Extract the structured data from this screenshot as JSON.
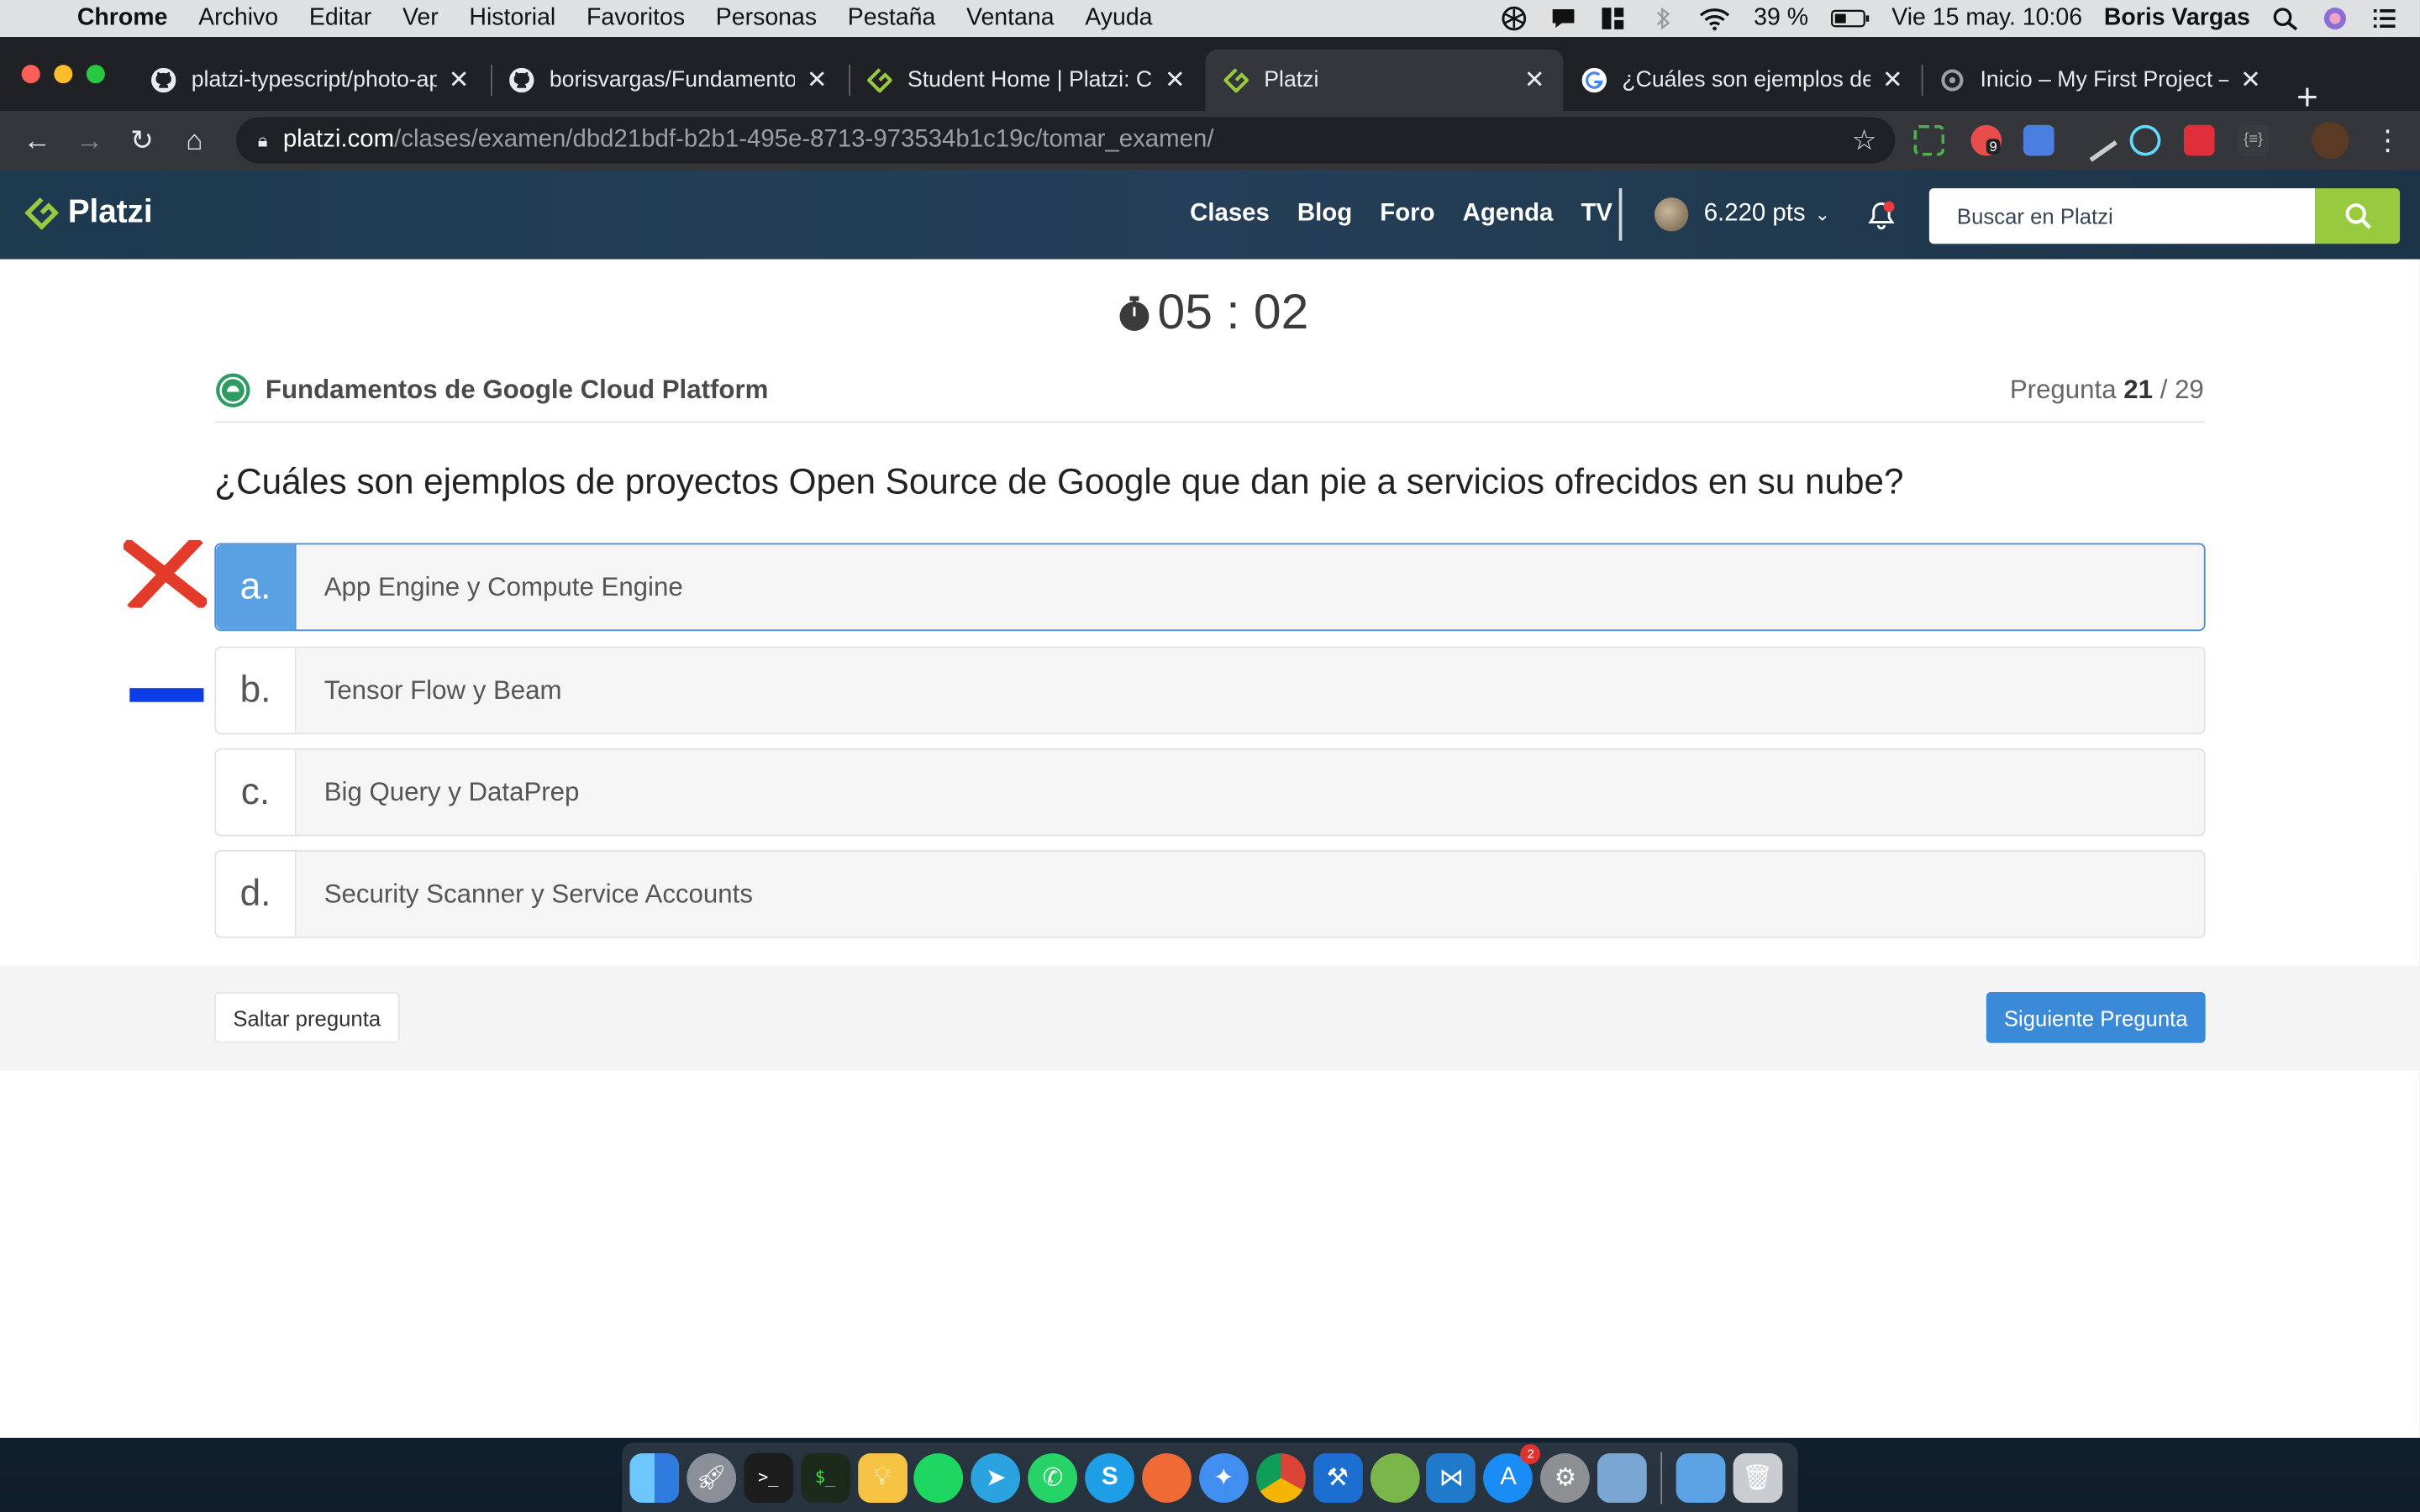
{
  "menubar": {
    "app": "Chrome",
    "items": [
      "Archivo",
      "Editar",
      "Ver",
      "Historial",
      "Favoritos",
      "Personas",
      "Pestaña",
      "Ventana",
      "Ayuda"
    ],
    "battery": "39 %",
    "datetime": "Vie 15 may.  10:06",
    "user": "Boris Vargas"
  },
  "browser": {
    "tabs": [
      {
        "title": "platzi-typescript/photo-ap",
        "icon": "github-icon"
      },
      {
        "title": "borisvargas/Fundamentos",
        "icon": "github-icon"
      },
      {
        "title": "Student Home | Platzi: Cu",
        "icon": "platzi-icon"
      },
      {
        "title": "Platzi",
        "icon": "platzi-icon",
        "active": true
      },
      {
        "title": "¿Cuáles son ejemplos de p",
        "icon": "google-icon"
      },
      {
        "title": "Inicio – My First Project – G",
        "icon": "gcp-icon"
      }
    ],
    "url_host": "platzi.com",
    "url_path": "/clases/examen/dbd21bdf-b2b1-495e-8713-973534b1c19c/tomar_examen/",
    "extension_badge": "9"
  },
  "platzi": {
    "logo": "Platzi",
    "nav": [
      "Clases",
      "Blog",
      "Foro",
      "Agenda",
      "TV"
    ],
    "points": "6.220 pts",
    "search_placeholder": "Buscar en Platzi"
  },
  "exam": {
    "timer": "05 : 02",
    "course": "Fundamentos de Google Cloud Platform",
    "question_label": "Pregunta",
    "question_current": "21",
    "question_total": "/ 29",
    "question": "¿Cuáles son ejemplos de proyectos Open Source de Google que dan pie a servicios ofrecidos en su nube?",
    "options": [
      {
        "letter": "a.",
        "text": "App Engine y Compute Engine",
        "selected": true
      },
      {
        "letter": "b.",
        "text": "Tensor Flow y Beam"
      },
      {
        "letter": "c.",
        "text": "Big Query y DataPrep"
      },
      {
        "letter": "d.",
        "text": "Security Scanner y Service Accounts"
      }
    ],
    "skip_label": "Saltar pregunta",
    "next_label": "Siguiente Pregunta"
  },
  "colors": {
    "platzi_green": "#98ca3f",
    "selected_blue": "#5aa1e3",
    "next_button": "#3a8ad8",
    "wrong_mark": "#e23b2a",
    "dash_mark": "#0b3ce6"
  },
  "dock": {
    "apps": [
      "finder-icon",
      "launchpad-icon",
      "terminal-icon",
      "iterm-icon",
      "tips-icon",
      "spotify-icon",
      "telegram-icon",
      "whatsapp-icon",
      "skype-icon",
      "postman-icon",
      "safari-icon",
      "chrome-icon",
      "xcode-icon",
      "android-studio-icon",
      "vscode-icon",
      "app-store-icon",
      "system-preferences-icon",
      "preview-icon",
      "downloads-folder-icon",
      "trash-icon"
    ],
    "app_store_badge": "2"
  }
}
